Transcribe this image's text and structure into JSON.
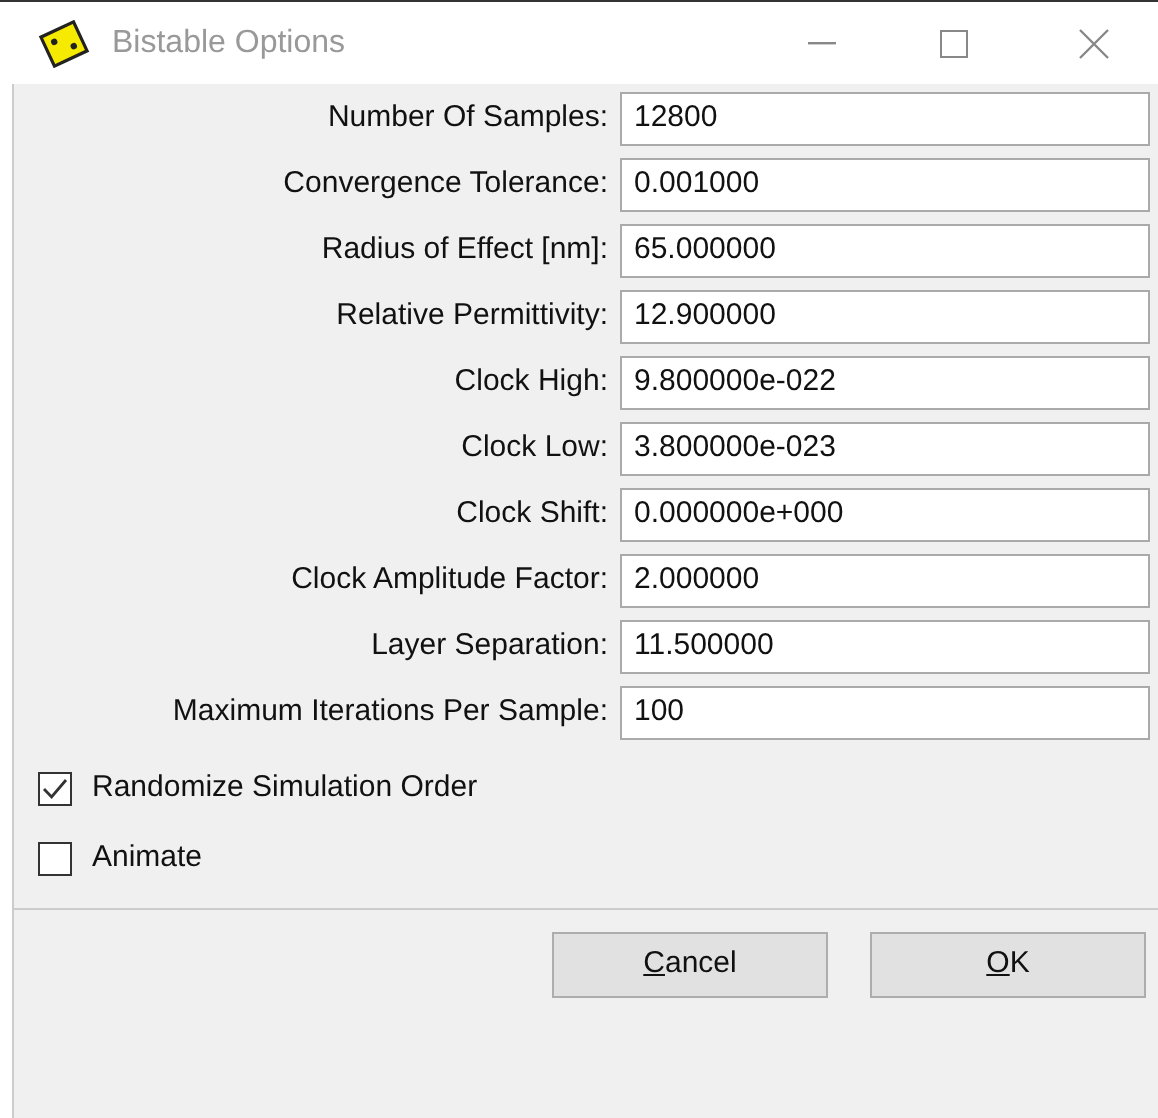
{
  "window": {
    "title": "Bistable Options"
  },
  "fields": [
    {
      "label": "Number Of Samples:",
      "value": "12800"
    },
    {
      "label": "Convergence Tolerance:",
      "value": "0.001000"
    },
    {
      "label": "Radius of Effect [nm]:",
      "value": "65.000000"
    },
    {
      "label": "Relative Permittivity:",
      "value": "12.900000"
    },
    {
      "label": "Clock High:",
      "value": "9.800000e-022"
    },
    {
      "label": "Clock Low:",
      "value": "3.800000e-023"
    },
    {
      "label": "Clock Shift:",
      "value": "0.000000e+000"
    },
    {
      "label": "Clock Amplitude Factor:",
      "value": "2.000000"
    },
    {
      "label": "Layer Separation:",
      "value": "11.500000"
    },
    {
      "label": "Maximum Iterations Per Sample:",
      "value": "100"
    }
  ],
  "checkboxes": [
    {
      "label": "Randomize Simulation Order",
      "checked": true
    },
    {
      "label": "Animate",
      "checked": false
    }
  ],
  "buttons": [
    {
      "mnemonic": "C",
      "rest": "ancel"
    },
    {
      "mnemonic": "O",
      "rest": "K"
    }
  ]
}
